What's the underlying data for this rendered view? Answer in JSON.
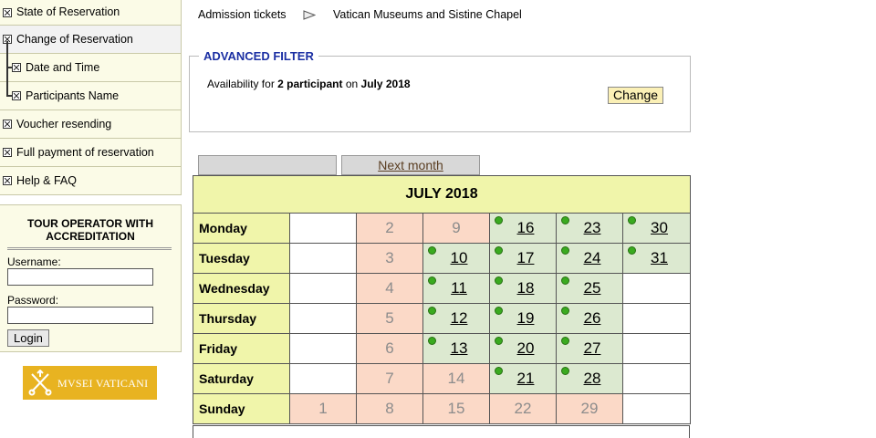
{
  "sidebar": {
    "items": [
      {
        "label": "State of Reservation",
        "sub": false,
        "active": false
      },
      {
        "label": "Change of Reservation",
        "sub": false,
        "active": true
      },
      {
        "label": "Date and Time",
        "sub": true,
        "active": false
      },
      {
        "label": "Participants Name",
        "sub": true,
        "active": false
      },
      {
        "label": "Voucher resending",
        "sub": false,
        "active": false
      },
      {
        "label": "Full payment of reservation",
        "sub": false,
        "active": false
      },
      {
        "label": "Help & FAQ",
        "sub": false,
        "active": false
      }
    ],
    "icon": "checkbox-icon"
  },
  "login": {
    "title_line1": "TOUR OPERATOR WITH",
    "title_line2": "ACCREDITATION",
    "username_label": "Username:",
    "password_label": "Password:",
    "username_value": "",
    "password_value": "",
    "button": "Login"
  },
  "logo": {
    "text": "MVSEI VATICANI",
    "icon": "crossed-keys-icon",
    "color": "#e8b321"
  },
  "breadcrumb": {
    "first": "Admission tickets",
    "separator_icon": "triangle-right-icon",
    "second": "Vatican Museums and Sistine Chapel"
  },
  "filter": {
    "title": "ADVANCED FILTER",
    "text_prefix": "Availability for ",
    "participants": "2 participant",
    "text_middle": " on ",
    "month": "July 2018",
    "change_button": "Change"
  },
  "nav": {
    "prev_label": "",
    "next_label": "Next month"
  },
  "calendar": {
    "title": "JULY 2018",
    "colors": {
      "header": "#f0f5aa",
      "unavailable": "#fbd9c7",
      "available": "#dce9d0",
      "available_dot": "#3aaa1f"
    },
    "rows": [
      {
        "day": "Monday",
        "cells": [
          null,
          {
            "n": "2",
            "s": "u"
          },
          {
            "n": "9",
            "s": "u"
          },
          {
            "n": "16",
            "s": "a"
          },
          {
            "n": "23",
            "s": "a"
          },
          {
            "n": "30",
            "s": "a"
          }
        ]
      },
      {
        "day": "Tuesday",
        "cells": [
          null,
          {
            "n": "3",
            "s": "u"
          },
          {
            "n": "10",
            "s": "a"
          },
          {
            "n": "17",
            "s": "a"
          },
          {
            "n": "24",
            "s": "a"
          },
          {
            "n": "31",
            "s": "a"
          }
        ]
      },
      {
        "day": "Wednesday",
        "cells": [
          null,
          {
            "n": "4",
            "s": "u"
          },
          {
            "n": "11",
            "s": "a"
          },
          {
            "n": "18",
            "s": "a"
          },
          {
            "n": "25",
            "s": "a"
          },
          null
        ]
      },
      {
        "day": "Thursday",
        "cells": [
          null,
          {
            "n": "5",
            "s": "u"
          },
          {
            "n": "12",
            "s": "a"
          },
          {
            "n": "19",
            "s": "a"
          },
          {
            "n": "26",
            "s": "a"
          },
          null
        ]
      },
      {
        "day": "Friday",
        "cells": [
          null,
          {
            "n": "6",
            "s": "u"
          },
          {
            "n": "13",
            "s": "a"
          },
          {
            "n": "20",
            "s": "a"
          },
          {
            "n": "27",
            "s": "a"
          },
          null
        ]
      },
      {
        "day": "Saturday",
        "cells": [
          null,
          {
            "n": "7",
            "s": "u"
          },
          {
            "n": "14",
            "s": "u"
          },
          {
            "n": "21",
            "s": "a"
          },
          {
            "n": "28",
            "s": "a"
          },
          null
        ]
      },
      {
        "day": "Sunday",
        "cells": [
          {
            "n": "1",
            "s": "u"
          },
          {
            "n": "8",
            "s": "u"
          },
          {
            "n": "15",
            "s": "u"
          },
          {
            "n": "22",
            "s": "u"
          },
          {
            "n": "29",
            "s": "u"
          },
          null
        ]
      }
    ]
  }
}
